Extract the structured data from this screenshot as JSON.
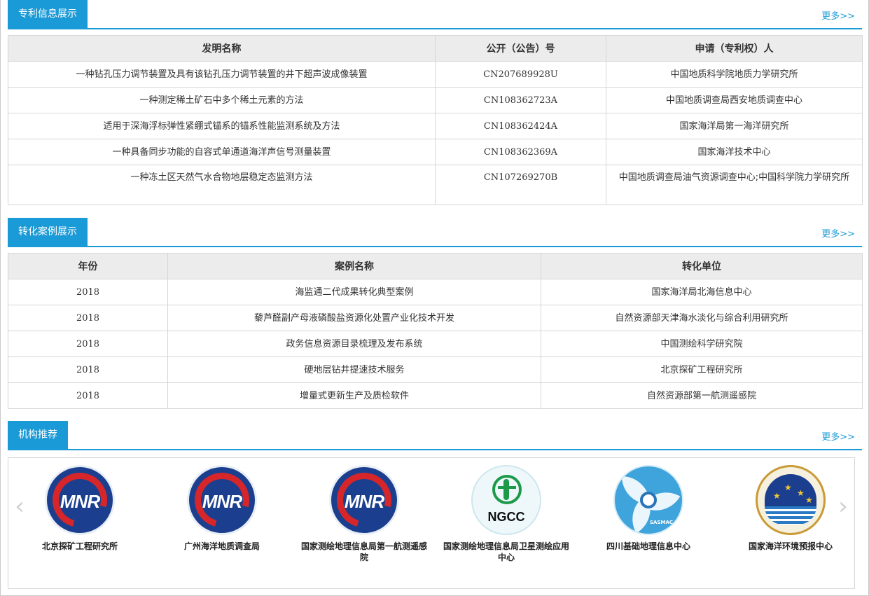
{
  "patent_section": {
    "title": "专利信息展示",
    "more": "更多>>",
    "columns": [
      "发明名称",
      "公开（公告）号",
      "申请（专利权）人"
    ],
    "rows": [
      [
        "一种钻孔压力调节装置及具有该钻孔压力调节装置的井下超声波成像装置",
        "CN207689928U",
        "中国地质科学院地质力学研究所"
      ],
      [
        "一种测定稀土矿石中多个稀土元素的方法",
        "CN108362723A",
        "中国地质调查局西安地质调查中心"
      ],
      [
        "适用于深海浮标弹性紧绷式锚系的锚系性能监测系统及方法",
        "CN108362424A",
        "国家海洋局第一海洋研究所"
      ],
      [
        "一种具备同步功能的自容式单通道海洋声信号测量装置",
        "CN108362369A",
        "国家海洋技术中心"
      ],
      [
        "一种冻土区天然气水合物地层稳定态监测方法",
        "CN107269270B",
        "中国地质调查局油气资源调查中心;中国科学院力学研究所"
      ]
    ]
  },
  "case_section": {
    "title": "转化案例展示",
    "more": "更多>>",
    "columns": [
      "年份",
      "案例名称",
      "转化单位"
    ],
    "rows": [
      [
        "2018",
        "海监通二代成果转化典型案例",
        "国家海洋局北海信息中心"
      ],
      [
        "2018",
        "藜芦醛副产母液磷酸盐资源化处置产业化技术开发",
        "自然资源部天津海水淡化与综合利用研究所"
      ],
      [
        "2018",
        "政务信息资源目录梳理及发布系统",
        "中国测绘科学研究院"
      ],
      [
        "2018",
        "硬地层钻井提速技术服务",
        "北京探矿工程研究所"
      ],
      [
        "2018",
        "增量式更新生产及质检软件",
        "自然资源部第一航测遥感院"
      ]
    ]
  },
  "org_section": {
    "title": "机构推荐",
    "more": "更多>>",
    "prev_arrow": "‹",
    "next_arrow": "›",
    "items": [
      {
        "name": "北京探矿工程研究所",
        "logo": "mnr-logo",
        "logo_text": "MNR"
      },
      {
        "name": "广州海洋地质调查局",
        "logo": "mnr-logo",
        "logo_text": "MNR"
      },
      {
        "name": "国家测绘地理信息局第一航测遥感院",
        "logo": "mnr-logo",
        "logo_text": "MNR"
      },
      {
        "name": "国家测绘地理信息局卫星测绘应用中心",
        "logo": "ngcc-logo",
        "logo_text": "NGCC"
      },
      {
        "name": "四川基础地理信息中心",
        "logo": "sasmac-logo",
        "logo_text": "SASMAC"
      },
      {
        "name": "国家海洋环境预报中心",
        "logo": "soa-logo",
        "logo_text": ""
      }
    ]
  },
  "colors": {
    "accent": "#1a9ad6",
    "header_bg": "#ececec",
    "border": "#d6d6d6"
  }
}
